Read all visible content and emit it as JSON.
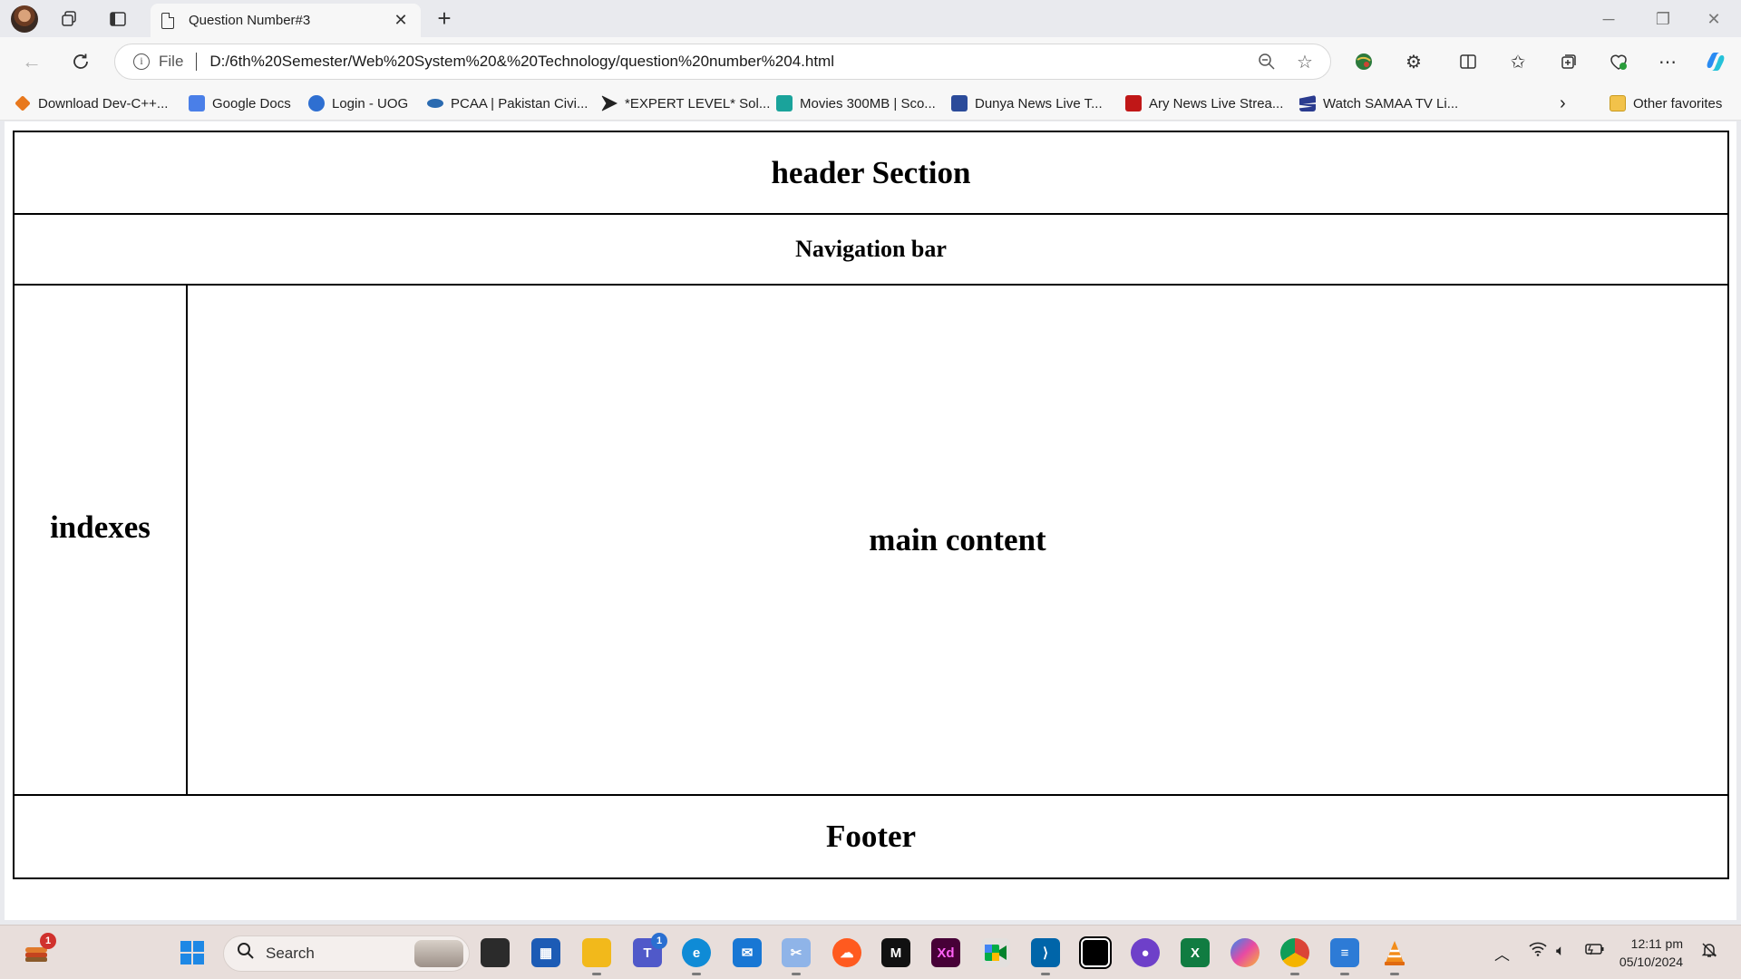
{
  "browser": {
    "tab_title": "Question Number#3",
    "address_prefix": "File",
    "url": "D:/6th%20Semester/Web%20System%20&%20Technology/question%20number%204.html"
  },
  "favorites": [
    {
      "label": "Download Dev-C++...",
      "color": "#e8781d"
    },
    {
      "label": "Google Docs",
      "color": "#4a7fe8"
    },
    {
      "label": "Login - UOG",
      "color": "#2e6fd1"
    },
    {
      "label": "PCAA | Pakistan Civi...",
      "color": "#2a6ab0"
    },
    {
      "label": "*EXPERT LEVEL* Sol...",
      "color": "#222222"
    },
    {
      "label": "Movies 300MB | Sco...",
      "color": "#1aa39b"
    },
    {
      "label": "Dunya News Live T...",
      "color": "#2b4b9a"
    },
    {
      "label": "Ary News Live Strea...",
      "color": "#c01717"
    },
    {
      "label": "Watch SAMAA TV Li...",
      "color": "#2a3b8f"
    }
  ],
  "other_favorites": "Other favorites",
  "page": {
    "header": "header Section",
    "nav": "Navigation bar",
    "sidebar": "indexes",
    "main": "main content",
    "footer": "Footer"
  },
  "taskbar": {
    "search_placeholder": "Search",
    "widget_badge": "1",
    "teams_badge": "1",
    "time": "12:11 pm",
    "date": "05/10/2024"
  }
}
